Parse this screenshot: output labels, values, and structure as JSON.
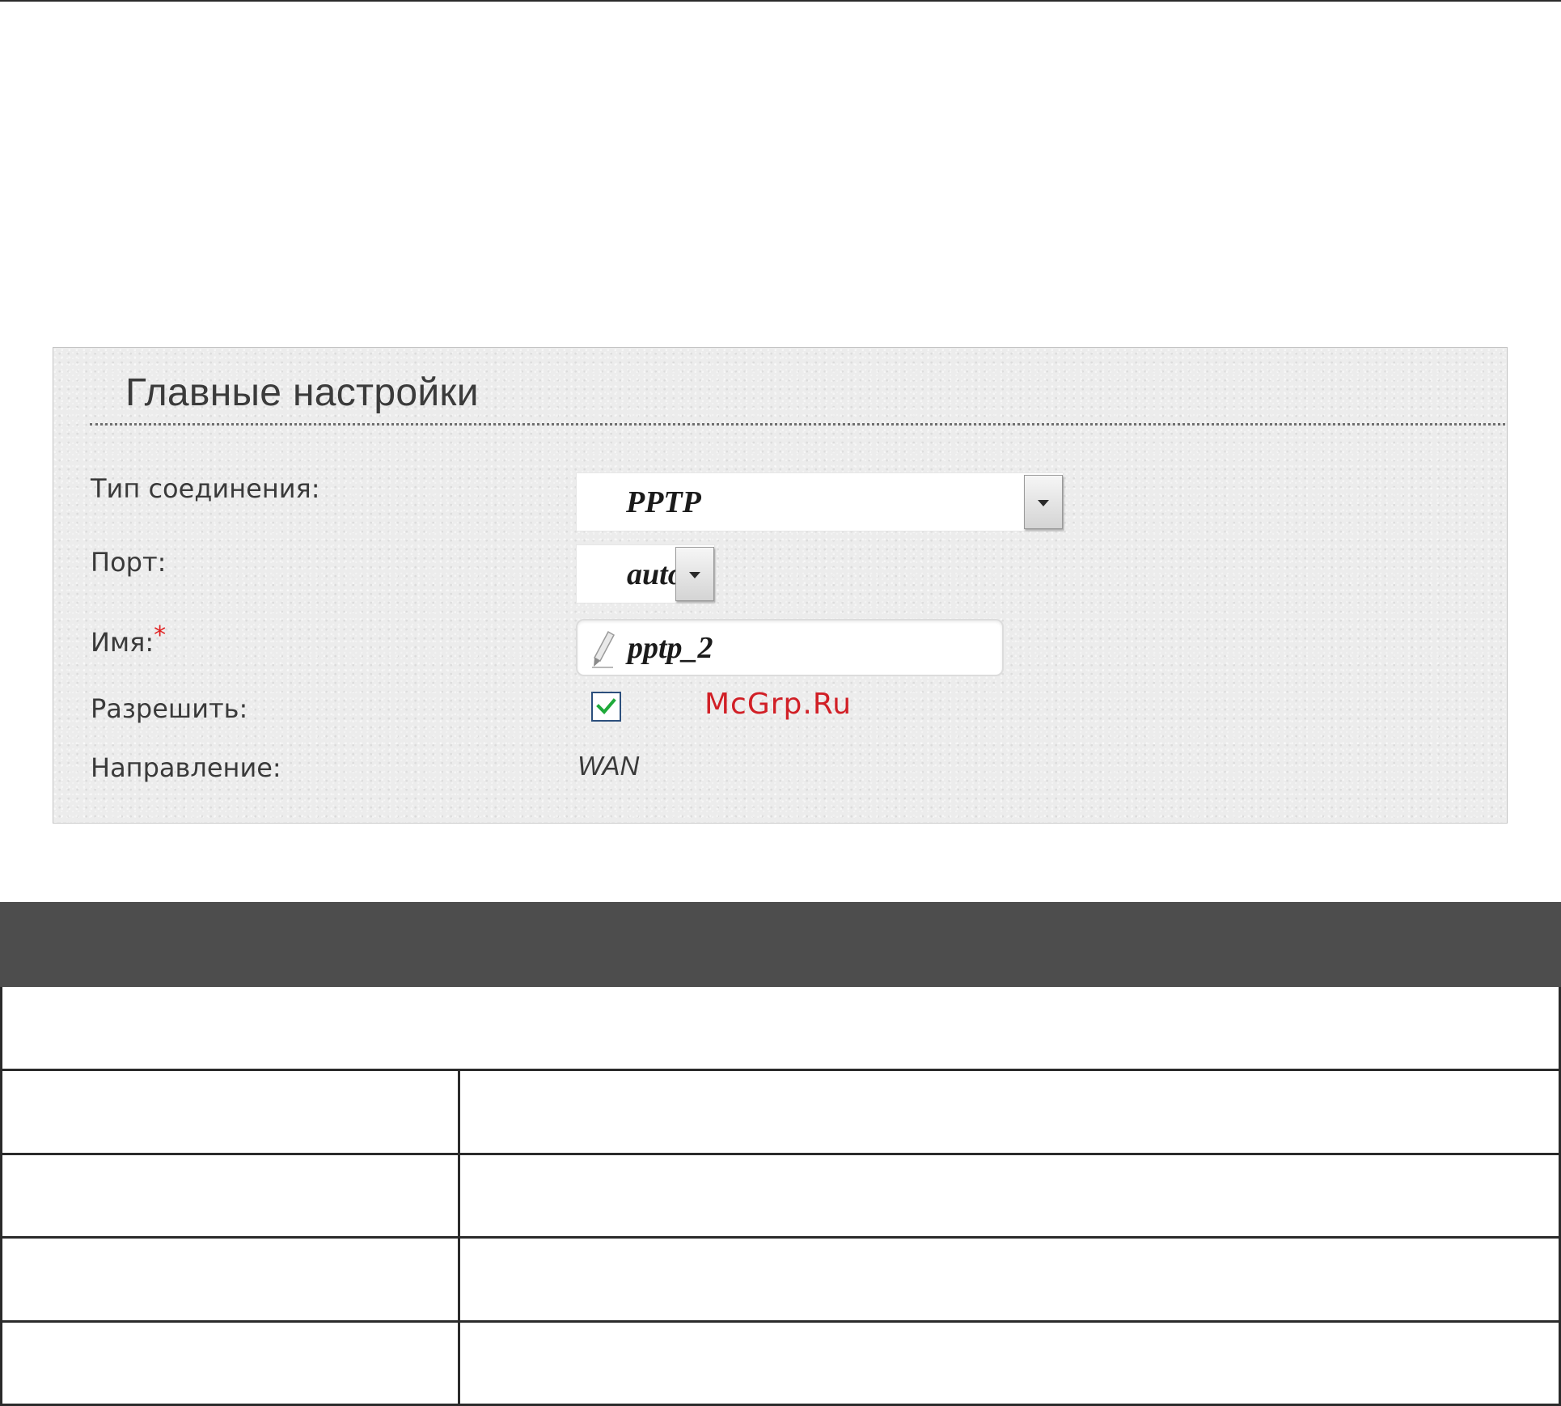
{
  "settings_panel": {
    "title": "Главные настройки",
    "fields": {
      "connection_type": {
        "label": "Тип соединения:",
        "value": "PPTP"
      },
      "port": {
        "label": "Порт:",
        "value": "auto"
      },
      "name": {
        "label": "Имя:",
        "required_marker": "*",
        "value": "pptp_2"
      },
      "enable": {
        "label": "Разрешить:",
        "checked": true
      },
      "direction": {
        "label": "Направление:",
        "value": "WAN"
      }
    },
    "watermark": "McGrp.Ru"
  },
  "icons": {
    "connection_type_dropdown": "chevron-down-icon",
    "port_dropdown": "chevron-down-icon",
    "name_input": "pencil-icon",
    "enable_checkbox": "checkmark-icon"
  },
  "colors": {
    "panel_background": "#ececec",
    "title_text": "#3b3b3b",
    "required_marker": "#e02020",
    "checkbox_border": "#2c4f7c",
    "checkmark": "#1faa3a",
    "watermark": "#d11f26",
    "table_header": "#4d4d4d",
    "table_lines": "#2b2b2b"
  }
}
